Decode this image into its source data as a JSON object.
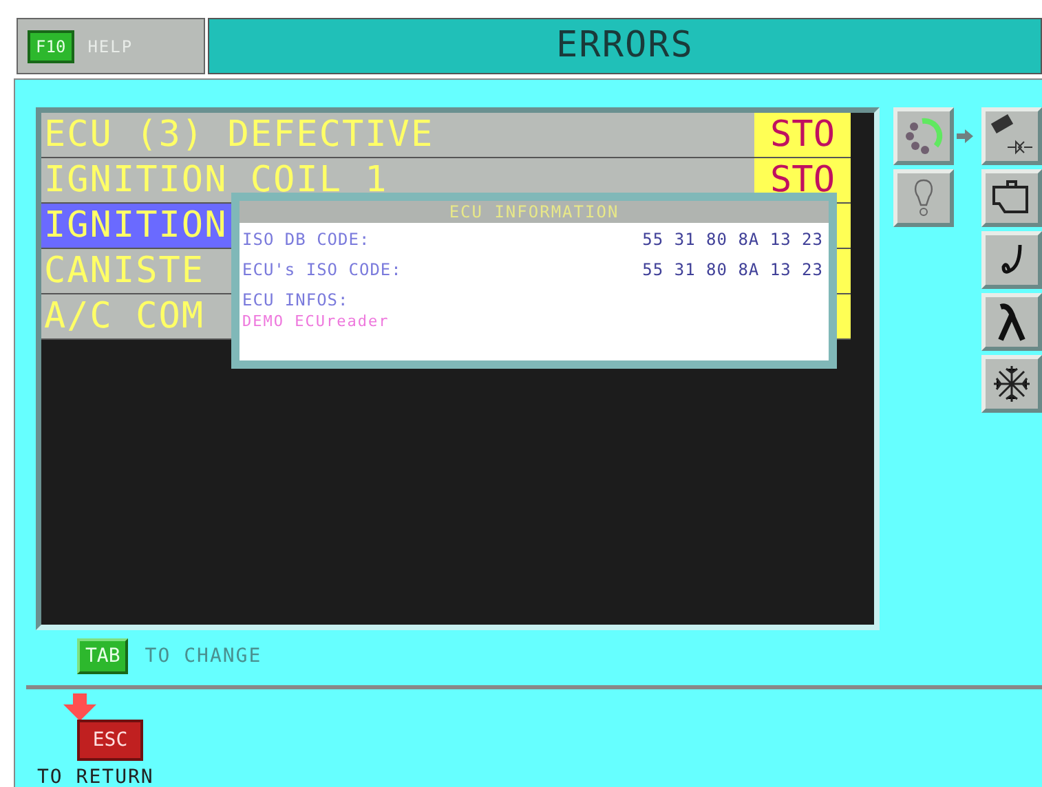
{
  "header": {
    "help_key": "F10",
    "help_label": "HELP",
    "title": "ERRORS"
  },
  "errors": [
    {
      "text": "ECU (3) DEFECTIVE",
      "status": "STO",
      "selected": false
    },
    {
      "text": "IGNITION COIL 1",
      "status": "STO",
      "selected": false
    },
    {
      "text": "IGNITION",
      "selected": true
    },
    {
      "text": "CANISTE",
      "selected": false
    },
    {
      "text": "A/C COM",
      "selected": false
    }
  ],
  "popup": {
    "title": "ECU INFORMATION",
    "fields": [
      {
        "label": "ISO DB CODE:",
        "value": "55 31 80 8A 13 23"
      },
      {
        "label": "ECU's ISO CODE:",
        "value": "55 31 80 8A 13 23"
      }
    ],
    "infos_label": "ECU INFOS:",
    "infos_value": "DEMO ECUreader"
  },
  "tab_hint": {
    "key": "TAB",
    "label": "TO CHANGE"
  },
  "esc_hint": {
    "key": "ESC",
    "label": "TO RETURN"
  }
}
